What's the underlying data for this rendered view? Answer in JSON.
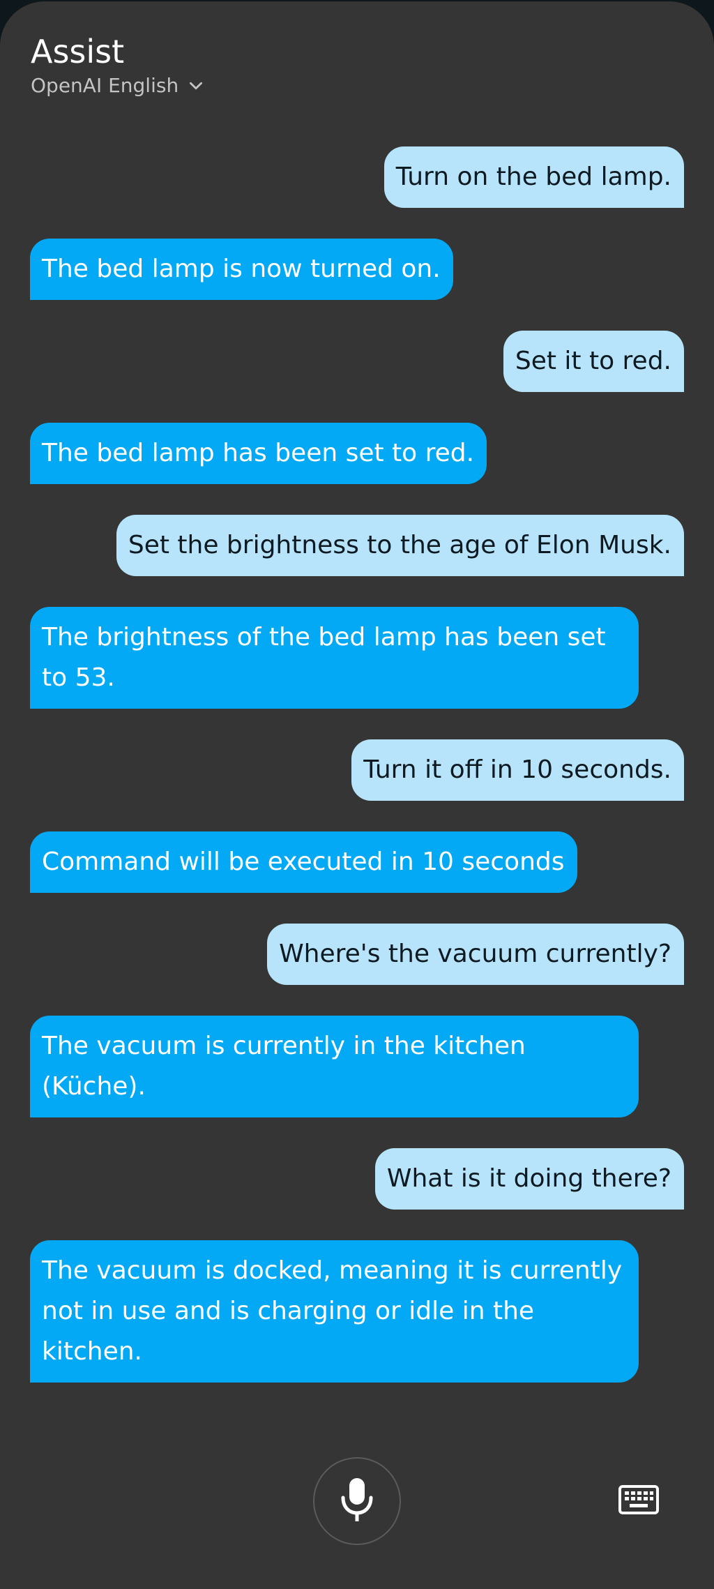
{
  "header": {
    "title": "Assist",
    "pipeline": "OpenAI English"
  },
  "messages": [
    {
      "role": "user",
      "text": "Turn on the bed lamp."
    },
    {
      "role": "assistant",
      "text": "The bed lamp is now turned on."
    },
    {
      "role": "user",
      "text": "Set it to red."
    },
    {
      "role": "assistant",
      "text": "The bed lamp has been set to red."
    },
    {
      "role": "user",
      "text": "Set the brightness to the age of Elon Musk."
    },
    {
      "role": "assistant",
      "text": "The brightness of the bed lamp has been set to 53."
    },
    {
      "role": "user",
      "text": "Turn it off in 10 seconds."
    },
    {
      "role": "assistant",
      "text": "Command will be executed in 10 seconds"
    },
    {
      "role": "user",
      "text": "Where's the vacuum currently?"
    },
    {
      "role": "assistant",
      "text": "The vacuum is currently in the kitchen (Küche)."
    },
    {
      "role": "user",
      "text": "What is it doing there?"
    },
    {
      "role": "assistant",
      "text": "The vacuum is docked, meaning it is currently not in use and is charging or idle in the kitchen."
    }
  ],
  "controls": {
    "mic_icon": "microphone-icon",
    "keyboard_icon": "keyboard-icon",
    "pipeline_icon": "chevron-down-icon"
  },
  "colors": {
    "background": "#353535",
    "user_bubble": "#b7e4fa",
    "assistant_bubble": "#03a9f4"
  }
}
